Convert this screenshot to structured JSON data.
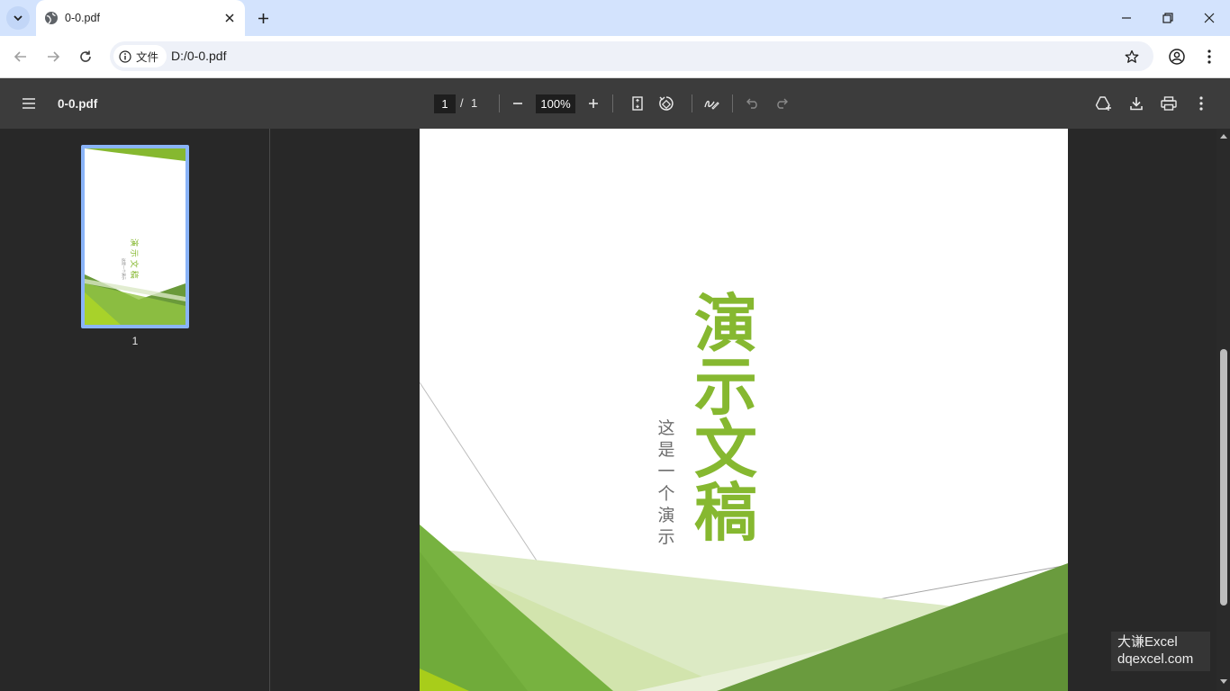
{
  "browser": {
    "tab_title": "0-0.pdf",
    "site_chip_label": "文件",
    "url": "D:/0-0.pdf"
  },
  "pdf_toolbar": {
    "document_title": "0-0.pdf",
    "current_page": "1",
    "page_separator": "/",
    "total_pages": "1",
    "zoom": "100%"
  },
  "sidebar": {
    "thumbnails": [
      {
        "page_number": "1"
      }
    ]
  },
  "document": {
    "title_chars": [
      "演",
      "示",
      "文",
      "稿"
    ],
    "subtitle_chars": [
      "这",
      "是",
      "一",
      "个",
      "演",
      "示"
    ],
    "accent_color": "#86b830"
  },
  "watermark": {
    "line1": "大谦Excel",
    "line2": "dqexcel.com"
  },
  "colors": {
    "tabstrip_bg": "#d3e3fd",
    "pdf_toolbar_bg": "#3c3c3c",
    "viewer_bg": "#282828",
    "thumb_border": "#8ab4f8"
  }
}
